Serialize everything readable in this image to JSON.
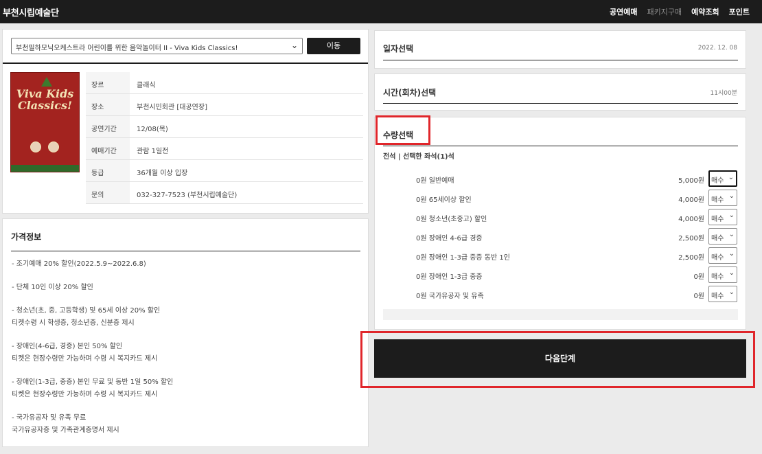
{
  "header": {
    "brand": "부천시립예술단",
    "nav": [
      "공연예매",
      "패키지구매",
      "예약조회",
      "포인트"
    ]
  },
  "show": {
    "selected": "부천필하모닉오케스트라 어린이를 위한 음악놀이터 II - Viva Kids Classics!",
    "move_label": "이동",
    "poster_title": "Viva Kids Classics!",
    "info": [
      {
        "k": "장르",
        "v": "클래식"
      },
      {
        "k": "장소",
        "v": "부천시민회관 [대공연장]"
      },
      {
        "k": "공연기간",
        "v": "12/08(목)"
      },
      {
        "k": "예매기간",
        "v": "관람 1일전"
      },
      {
        "k": "등급",
        "v": "36개월 이상 입장"
      },
      {
        "k": "문의",
        "v": "032-327-7523 (부천시립예술단)"
      }
    ]
  },
  "price_info": {
    "title": "가격정보",
    "groups": [
      [
        "- 조기예매 20% 할인(2022.5.9~2022.6.8)"
      ],
      [
        "- 단체 10인 이상 20% 할인"
      ],
      [
        "- 청소년(초, 중, 고등학생) 및 65세 이상 20% 할인",
        "티켓수령 시 학생증, 청소년증, 신분증 제시"
      ],
      [
        "- 장애인(4-6급, 경증) 본인 50% 할인",
        "티켓은 현장수령만 가능하며 수령 시 복지카드 제시"
      ],
      [
        "- 장애인(1-3급, 중증) 본인 무료 및 동반 1일 50% 할인",
        "티켓은 현장수령만 가능하며 수령 시 복지카드 제시"
      ],
      [
        "- 국가유공자 및 유족 무료",
        "국가유공자증 및 가족관계증명서 제시"
      ]
    ]
  },
  "date_section": {
    "title": "일자선택",
    "value": "2022. 12. 08"
  },
  "time_section": {
    "title": "시간(회차)선택",
    "value": "11시00분"
  },
  "qty_section": {
    "title": "수량선택",
    "subtitle": "전석 | 선택한 좌석(1)석",
    "select_label": "매수",
    "tickets": [
      {
        "label": "0원 일반예매",
        "price": "5,000원"
      },
      {
        "label": "0원 65세이상 할인",
        "price": "4,000원"
      },
      {
        "label": "0원 청소년(초중고) 할인",
        "price": "4,000원"
      },
      {
        "label": "0원 장애인 4-6급 경증",
        "price": "2,500원"
      },
      {
        "label": "0원 장애인 1-3급 중증 동반 1인",
        "price": "2,500원"
      },
      {
        "label": "0원 장애인 1-3급 중증",
        "price": "0원"
      },
      {
        "label": "0원 국가유공자 및 유족",
        "price": "0원"
      }
    ]
  },
  "next_label": "다음단계",
  "colors": {
    "dark": "#1c1c1c",
    "highlight": "#e0262b",
    "bg": "#ebebeb"
  }
}
